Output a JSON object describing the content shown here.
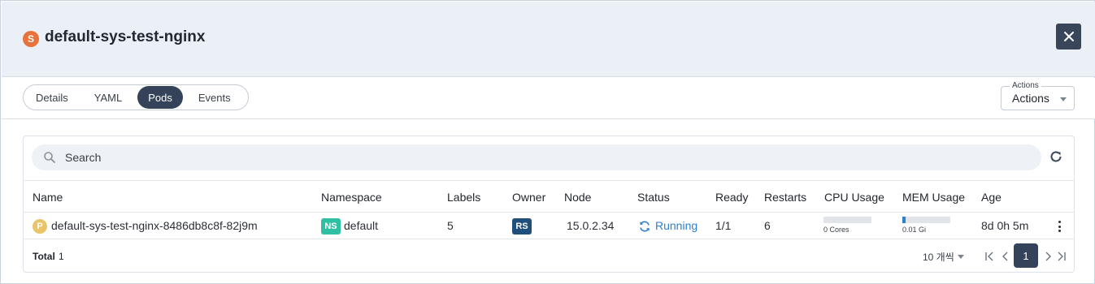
{
  "header": {
    "badge": "S",
    "title": "default-sys-test-nginx",
    "close_icon": "close-icon"
  },
  "tabs": [
    {
      "label": "Details",
      "active": false
    },
    {
      "label": "YAML",
      "active": false
    },
    {
      "label": "Pods",
      "active": true
    },
    {
      "label": "Events",
      "active": false
    }
  ],
  "actions": {
    "legend": "Actions",
    "value": "Actions"
  },
  "search": {
    "placeholder": "Search",
    "icon": "search-icon"
  },
  "table": {
    "columns": [
      "Name",
      "Namespace",
      "Labels",
      "Owner",
      "Node",
      "Status",
      "Ready",
      "Restarts",
      "CPU Usage",
      "MEM Usage",
      "Age"
    ],
    "rows": [
      {
        "badge": "P",
        "name": "default-sys-test-nginx-8486db8c8f-82j9m",
        "namespace_badge": "NS",
        "namespace": "default",
        "labels": "5",
        "owner_badge": "RS",
        "node": "15.0.2.34",
        "status": "Running",
        "ready": "1/1",
        "restarts": "6",
        "cpu_label": "0 Cores",
        "cpu_fraction": 0.0,
        "mem_label": "0.01 Gi",
        "mem_fraction": 0.06,
        "age": "8d 0h 5m"
      }
    ]
  },
  "footer": {
    "total_label": "Total",
    "total_value": "1",
    "per_page": "10 개씩",
    "current_page": "1"
  },
  "colors": {
    "service_badge": "#e8733a",
    "pod_badge": "#e9c46a",
    "namespace_badge": "#2fbfa3",
    "owner_badge": "#1f4f7a",
    "status_running": "#2f80d1",
    "active_tab": "#34425a"
  }
}
